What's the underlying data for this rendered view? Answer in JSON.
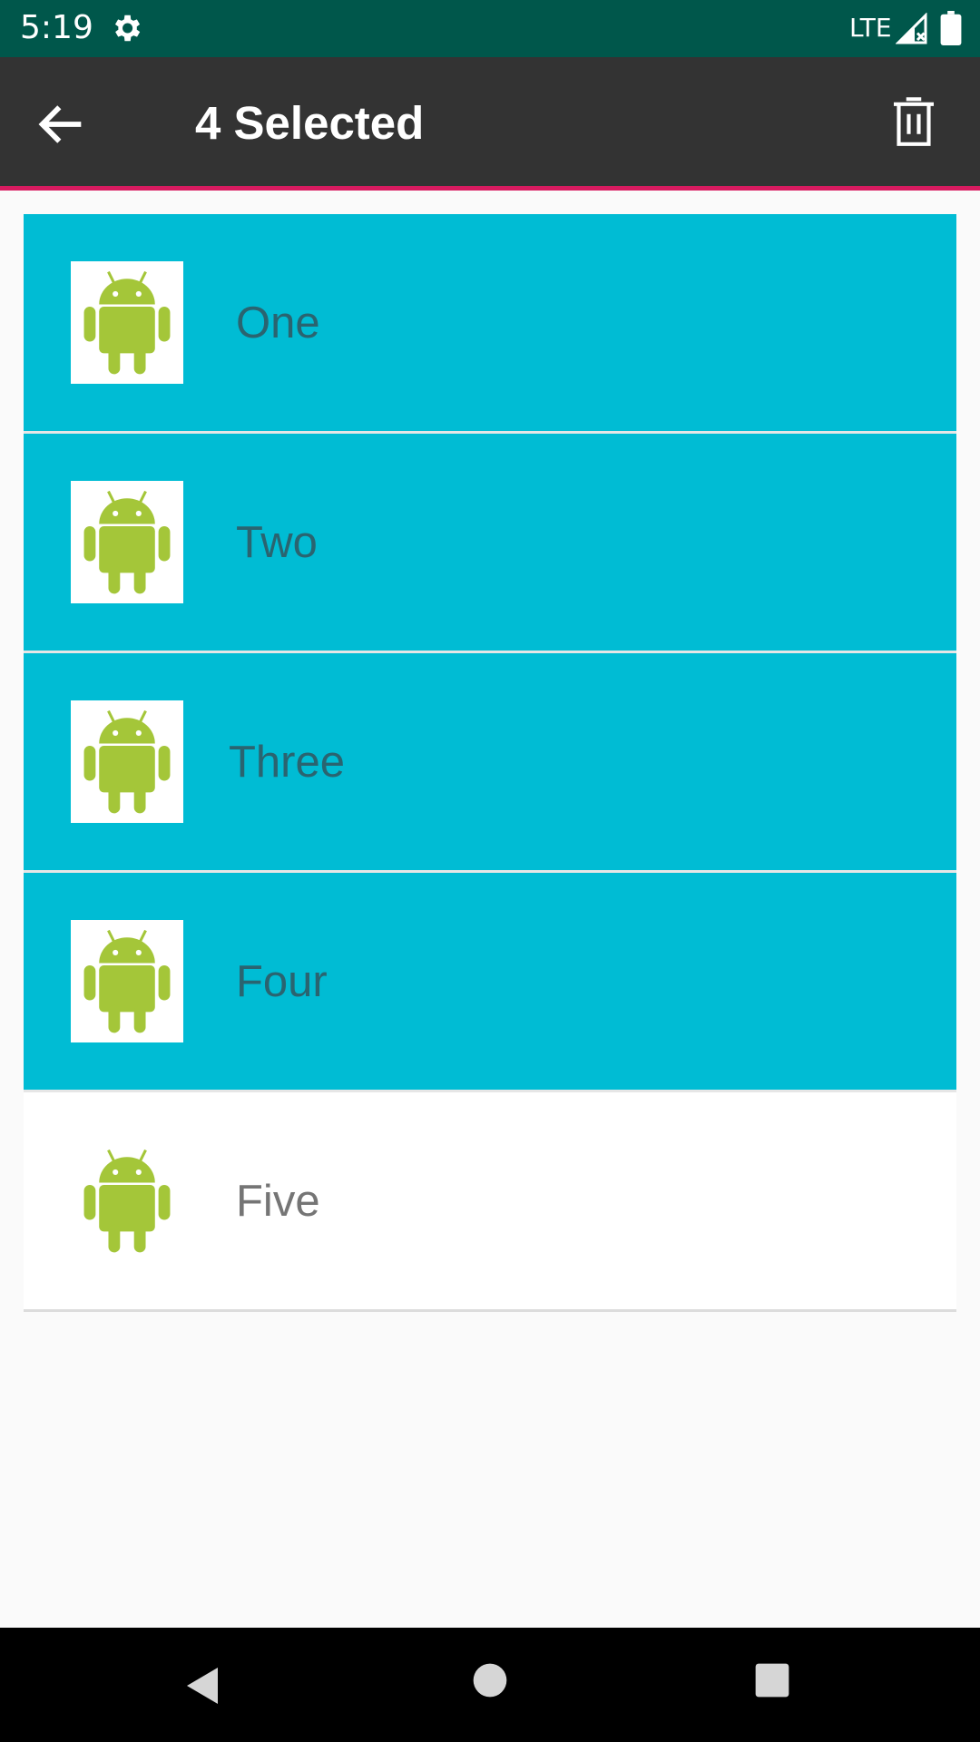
{
  "status_bar": {
    "time": "5:19",
    "network": "LTE",
    "icons": [
      "gear-icon",
      "signal-icon",
      "battery-icon"
    ]
  },
  "action_bar": {
    "title": "4 Selected",
    "back_icon": "arrow-left-icon",
    "delete_icon": "trash-icon",
    "accent_color": "#D81B60",
    "background_color": "#333333"
  },
  "list": {
    "selected_color": "#00BCD4",
    "items": [
      {
        "label": "One",
        "selected": true,
        "icon": "android-icon"
      },
      {
        "label": "Two",
        "selected": true,
        "icon": "android-icon"
      },
      {
        "label": "Three",
        "selected": true,
        "icon": "android-icon"
      },
      {
        "label": "Four",
        "selected": true,
        "icon": "android-icon"
      },
      {
        "label": "Five",
        "selected": false,
        "icon": "android-icon"
      }
    ]
  },
  "nav_bar": {
    "icons": [
      "nav-back-icon",
      "nav-home-icon",
      "nav-recents-icon"
    ]
  }
}
